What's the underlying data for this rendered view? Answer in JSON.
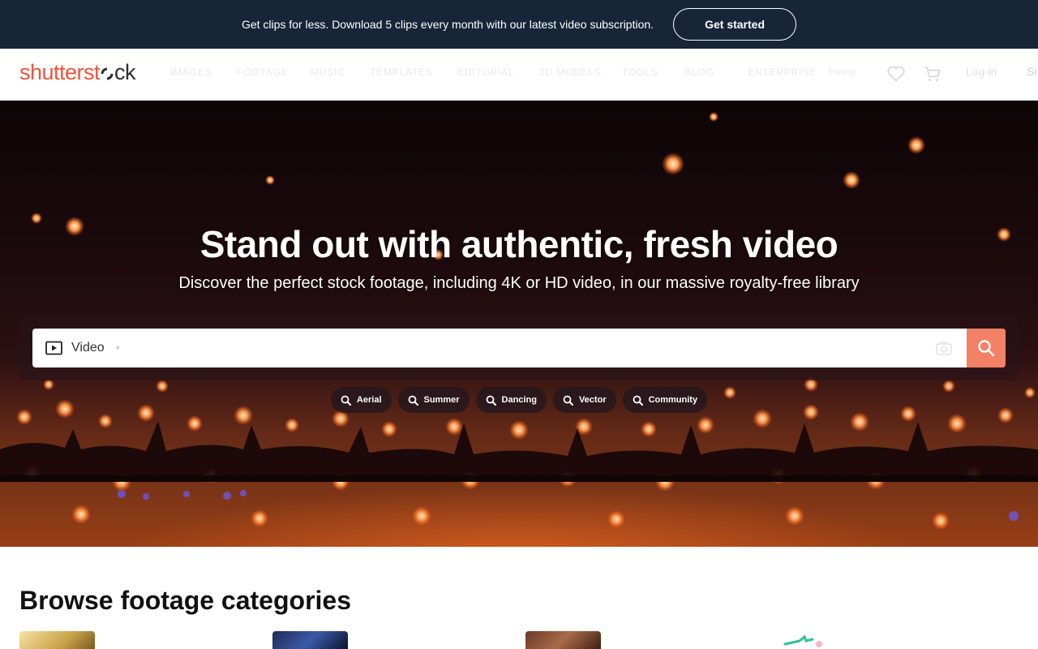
{
  "promo": {
    "text": "Get clips for less. Download 5 clips every month with our latest video subscription.",
    "cta": "Get started"
  },
  "header": {
    "logo_part1": "shutterst",
    "logo_part2": "ck",
    "nav": [
      "IMAGES",
      "FOOTAGE",
      "MUSIC",
      "TEMPLATES",
      "EDITORIAL",
      "3D MODELS",
      "TOOLS",
      "BLOG",
      "ENTERPRISE",
      "Pricing"
    ],
    "login": "Log in",
    "signup": "Si",
    "icons": [
      "heart-icon",
      "cart-icon"
    ]
  },
  "hero": {
    "title": "Stand out with authentic, fresh video",
    "subtitle": "Discover the perfect stock footage, including 4K or HD video, in our massive royalty-free library"
  },
  "search": {
    "type_label": "Video",
    "placeholder": "",
    "icons": [
      "video-icon",
      "chevron-down-icon",
      "camera-search-icon",
      "search-icon"
    ]
  },
  "chips": [
    "Aerial",
    "Summer",
    "Dancing",
    "Vector",
    "Community"
  ],
  "browse": {
    "title": "Browse footage categories"
  },
  "colors": {
    "promo_bg": "#172538",
    "brand": "#f2533d",
    "search_button": "#f28166"
  }
}
